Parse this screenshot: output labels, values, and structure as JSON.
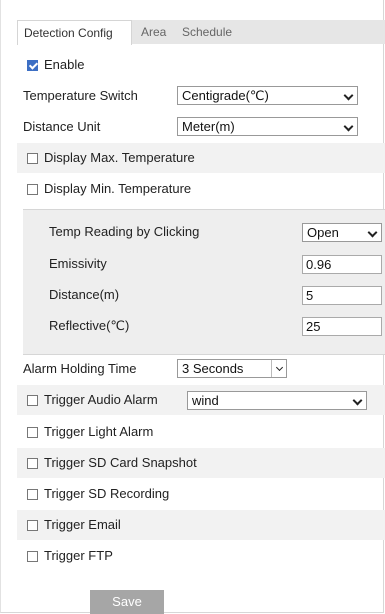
{
  "tabs": [
    {
      "label": "Detection Config",
      "active": true
    },
    {
      "label": "Area",
      "active": false
    },
    {
      "label": "Schedule",
      "active": false
    }
  ],
  "enable": {
    "label": "Enable",
    "checked": true
  },
  "temperature_switch": {
    "label": "Temperature Switch",
    "value": "Centigrade(℃)"
  },
  "distance_unit": {
    "label": "Distance Unit",
    "value": "Meter(m)"
  },
  "display_max": {
    "label": "Display Max. Temperature",
    "checked": false
  },
  "display_min": {
    "label": "Display Min. Temperature",
    "checked": false
  },
  "panel": {
    "temp_reading": {
      "label": "Temp Reading by Clicking",
      "value": "Open"
    },
    "emissivity": {
      "label": "Emissivity",
      "value": "0.96"
    },
    "distance": {
      "label": "Distance(m)",
      "value": "5"
    },
    "reflective": {
      "label": "Reflective(℃)",
      "value": "25"
    }
  },
  "alarm_holding_time": {
    "label": "Alarm Holding Time",
    "value": "3 Seconds"
  },
  "trigger_audio": {
    "label": "Trigger Audio Alarm",
    "value": "wind",
    "checked": false
  },
  "trigger_light": {
    "label": "Trigger Light Alarm",
    "checked": false
  },
  "trigger_sd_snapshot": {
    "label": "Trigger SD Card Snapshot",
    "checked": false
  },
  "trigger_sd_recording": {
    "label": "Trigger SD Recording",
    "checked": false
  },
  "trigger_email": {
    "label": "Trigger Email",
    "checked": false
  },
  "trigger_ftp": {
    "label": "Trigger FTP",
    "checked": false
  },
  "save_label": "Save",
  "colors": {
    "accent": "#3d6fc4",
    "save_button": "#a6a6a6",
    "row_gray": "#f2f2f2"
  }
}
